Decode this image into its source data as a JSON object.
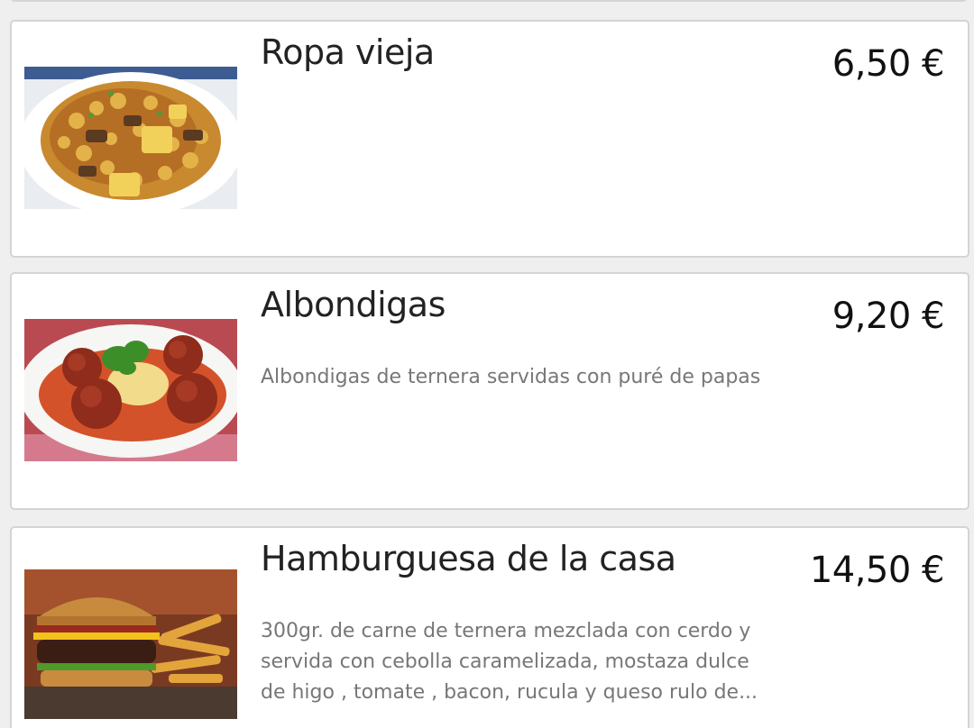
{
  "menu_items": [
    {
      "name": "Ropa vieja",
      "price": "6,50 €",
      "description": "",
      "image_icon": "ropa-vieja-photo"
    },
    {
      "name": "Albondigas",
      "price": "9,20 €",
      "description": "Albondigas de ternera servidas con puré de papas",
      "image_icon": "albondigas-photo"
    },
    {
      "name": "Hamburguesa de la casa",
      "price": "14,50 €",
      "description": "300gr. de carne de ternera mezclada con cerdo y servida con cebolla caramelizada, mostaza dulce de higo , tomate , bacon, rucula y queso rulo de...",
      "image_icon": "burger-photo"
    }
  ]
}
